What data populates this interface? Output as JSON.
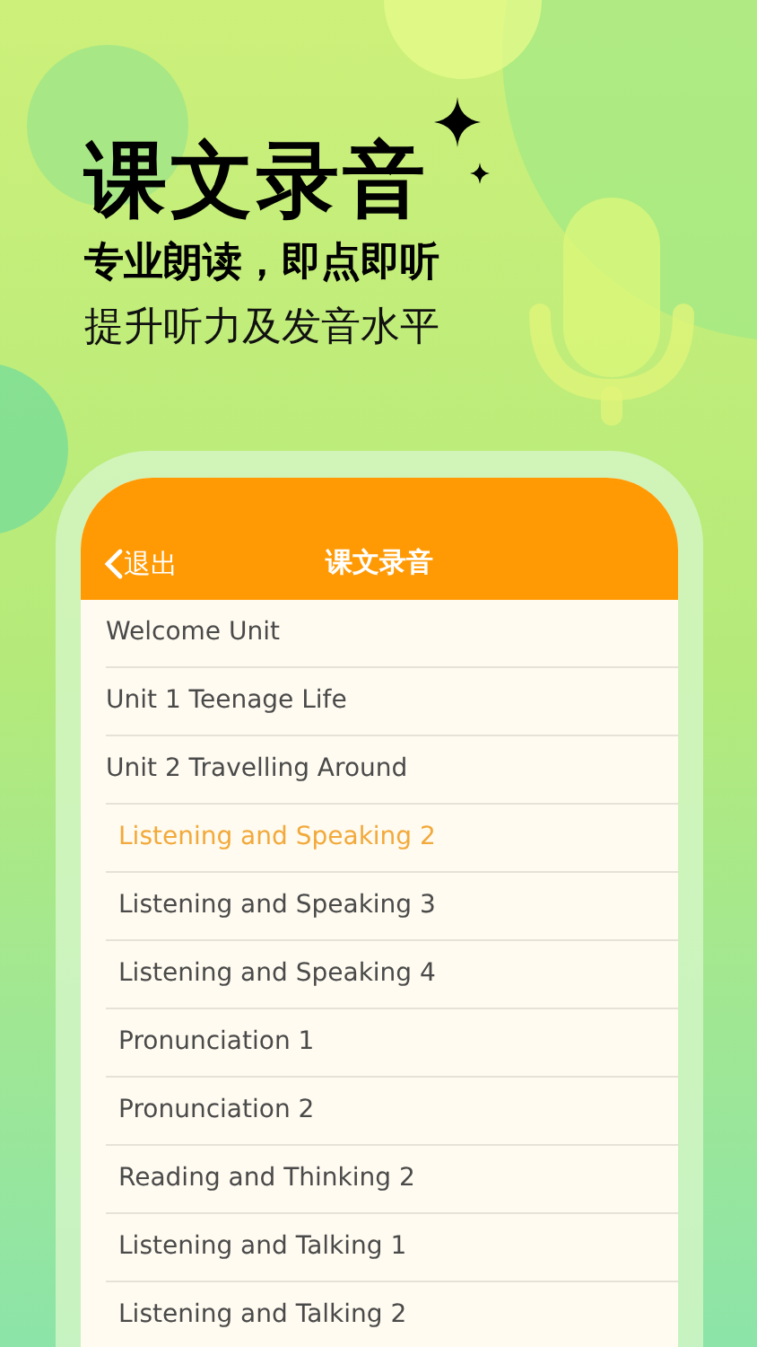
{
  "headline": "课文录音",
  "subtitle": "专业朗读，即点即听",
  "tagline": "提升听力及发音水平",
  "screen": {
    "back_label": "退出",
    "title": "课文录音",
    "items": [
      {
        "label": "Welcome Unit",
        "selected": false
      },
      {
        "label": "Unit 1 Teenage Life",
        "selected": false
      },
      {
        "label": "Unit 2 Travelling Around",
        "selected": false,
        "children": [
          {
            "label": "Listening and Speaking 2",
            "selected": true
          },
          {
            "label": "Listening and Speaking 3",
            "selected": false
          },
          {
            "label": "Listening and Speaking 4",
            "selected": false
          },
          {
            "label": "Pronunciation 1",
            "selected": false
          },
          {
            "label": "Pronunciation 2",
            "selected": false
          },
          {
            "label": "Reading and Thinking 2",
            "selected": false
          },
          {
            "label": "Listening and Talking 1",
            "selected": false
          },
          {
            "label": "Listening and Talking 2",
            "selected": false
          }
        ]
      }
    ]
  }
}
